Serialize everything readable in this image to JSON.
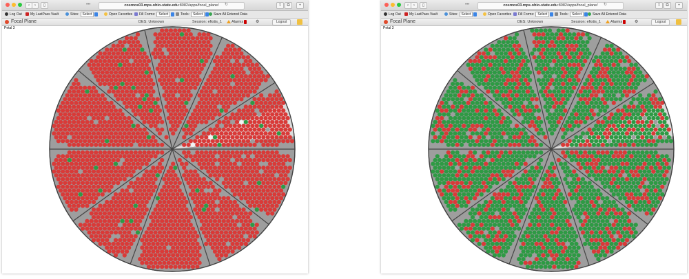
{
  "browser": {
    "url_host": "cosmos03.mps.ohio-state.edu",
    "url_rest": ":8082/apps/focal_plane/",
    "bookmarks": {
      "logout": "Log Out",
      "lastpass": "My LastPass Vault",
      "sites_label": "Sites:",
      "sites_value": "Select",
      "favorites": "Open Favorites",
      "fillforms_label": "Fill Forms:",
      "fillforms_value": "Select",
      "tools_label": "Tools:",
      "tools_value": "Select",
      "save_all": "Save All Entered Data"
    }
  },
  "app": {
    "title": "Focal Plane",
    "des_label": "DES: Unknown",
    "session_label": "Session: efiotis_1",
    "alarms_label": "Alarms",
    "logout_label": "Logout",
    "petal_label": "Petal 3"
  },
  "colors": {
    "red": "#d93a38",
    "green": "#2e9a44",
    "gray": "#9e9e9e",
    "light": "#dcdcdc",
    "outline": "#444444"
  },
  "icons": [
    "traffic-lights",
    "back-icon",
    "forward-icon",
    "sidebar-icon",
    "reload-icon",
    "share-icon",
    "tabs-icon",
    "plus-icon",
    "logout-icon",
    "lastpass-icon",
    "sites-icon",
    "favorites-icon",
    "fillforms-icon",
    "tools-icon",
    "save-icon",
    "focal-plane-logo",
    "alarm-icon",
    "tool-icon",
    "lock-icon"
  ],
  "panels": [
    {
      "id": "left",
      "description_state": "mostly-red",
      "green_ratio": 0.02
    },
    {
      "id": "right",
      "description_state": "mostly-green",
      "green_ratio": 0.72
    }
  ]
}
